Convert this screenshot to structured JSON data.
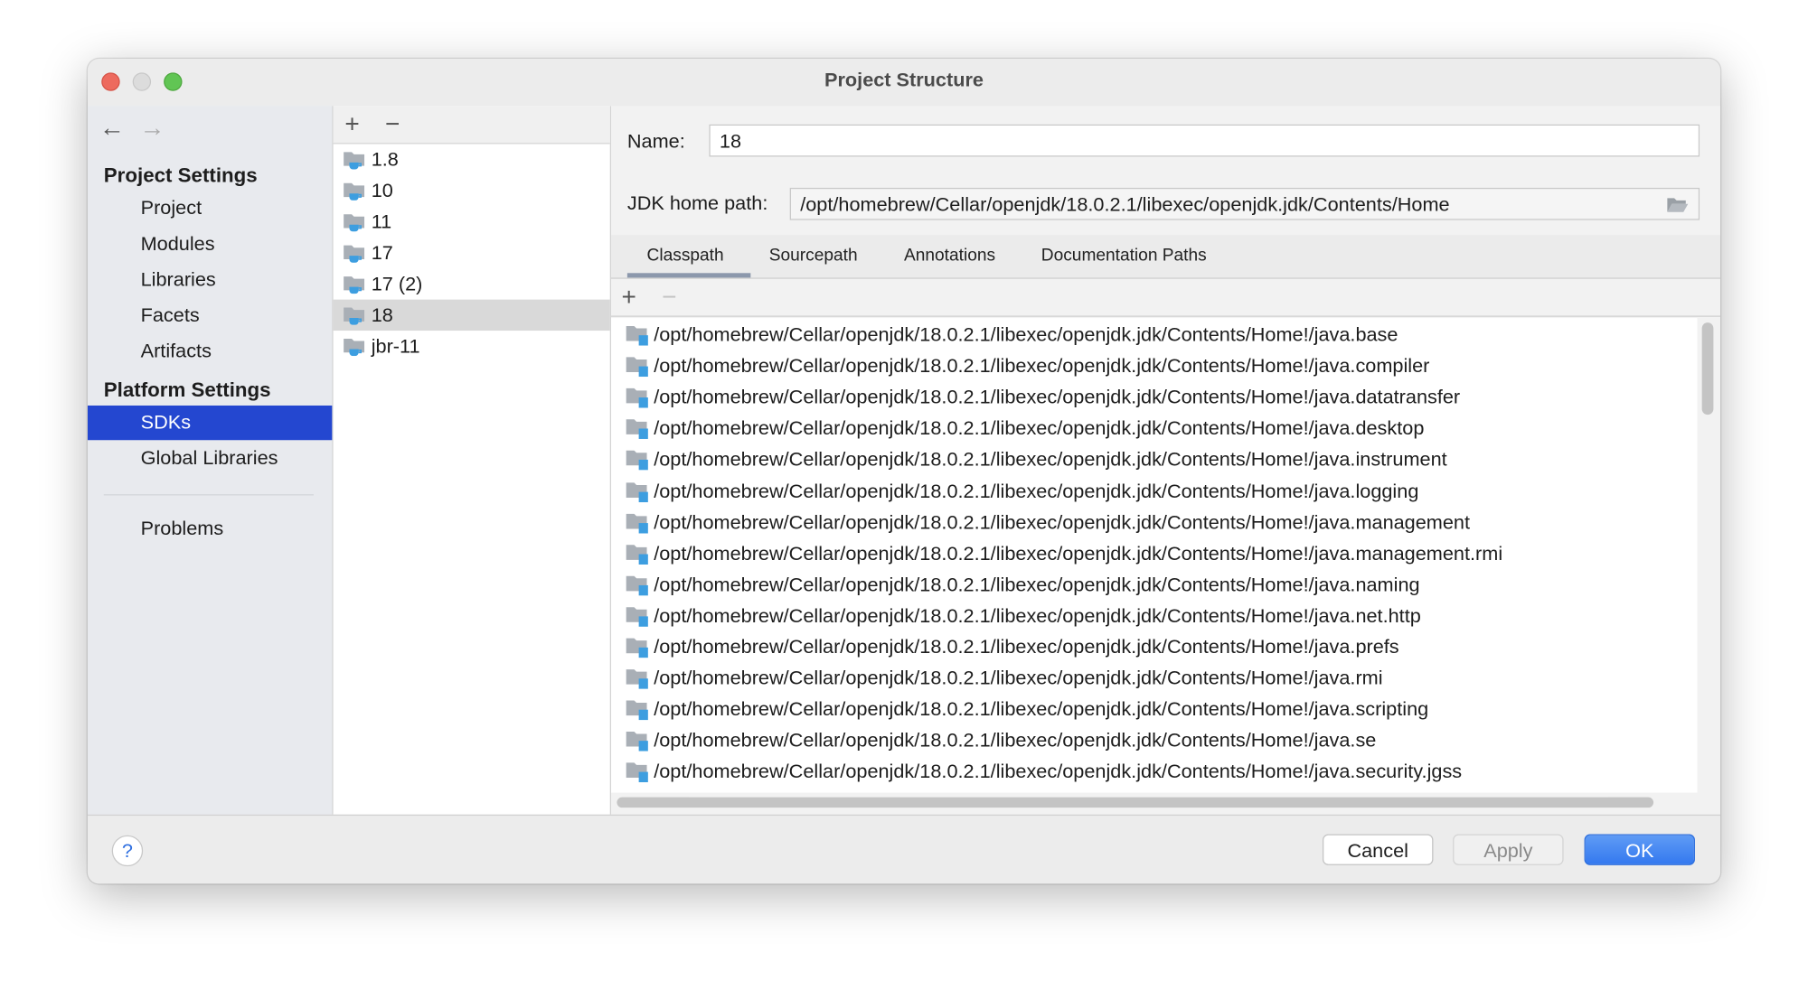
{
  "window": {
    "title": "Project Structure"
  },
  "sidebar": {
    "back_icon": "arrow-left-icon",
    "forward_icon": "arrow-right-icon",
    "project_settings_header": "Project Settings",
    "project_items": [
      {
        "label": "Project"
      },
      {
        "label": "Modules"
      },
      {
        "label": "Libraries"
      },
      {
        "label": "Facets"
      },
      {
        "label": "Artifacts"
      }
    ],
    "platform_settings_header": "Platform Settings",
    "platform_items": [
      {
        "label": "SDKs",
        "selected": true
      },
      {
        "label": "Global Libraries"
      }
    ],
    "problems": "Problems",
    "selected_color": "#2447d0"
  },
  "sdk_list": {
    "add": "+",
    "remove": "−",
    "items": [
      {
        "label": "1.8"
      },
      {
        "label": "10"
      },
      {
        "label": "11"
      },
      {
        "label": "17"
      },
      {
        "label": "17 (2)"
      },
      {
        "label": "18",
        "selected": true
      },
      {
        "label": "jbr-11"
      }
    ]
  },
  "detail": {
    "name_label": "Name:",
    "name_value": "18",
    "jdk_home_label": "JDK home path:",
    "jdk_home_value": "/opt/homebrew/Cellar/openjdk/18.0.2.1/libexec/openjdk.jdk/Contents/Home",
    "tabs": [
      {
        "label": "Classpath",
        "active": true
      },
      {
        "label": "Sourcepath"
      },
      {
        "label": "Annotations"
      },
      {
        "label": "Documentation Paths"
      }
    ],
    "add": "+",
    "remove": "−",
    "classpath": [
      "/opt/homebrew/Cellar/openjdk/18.0.2.1/libexec/openjdk.jdk/Contents/Home!/java.base",
      "/opt/homebrew/Cellar/openjdk/18.0.2.1/libexec/openjdk.jdk/Contents/Home!/java.compiler",
      "/opt/homebrew/Cellar/openjdk/18.0.2.1/libexec/openjdk.jdk/Contents/Home!/java.datatransfer",
      "/opt/homebrew/Cellar/openjdk/18.0.2.1/libexec/openjdk.jdk/Contents/Home!/java.desktop",
      "/opt/homebrew/Cellar/openjdk/18.0.2.1/libexec/openjdk.jdk/Contents/Home!/java.instrument",
      "/opt/homebrew/Cellar/openjdk/18.0.2.1/libexec/openjdk.jdk/Contents/Home!/java.logging",
      "/opt/homebrew/Cellar/openjdk/18.0.2.1/libexec/openjdk.jdk/Contents/Home!/java.management",
      "/opt/homebrew/Cellar/openjdk/18.0.2.1/libexec/openjdk.jdk/Contents/Home!/java.management.rmi",
      "/opt/homebrew/Cellar/openjdk/18.0.2.1/libexec/openjdk.jdk/Contents/Home!/java.naming",
      "/opt/homebrew/Cellar/openjdk/18.0.2.1/libexec/openjdk.jdk/Contents/Home!/java.net.http",
      "/opt/homebrew/Cellar/openjdk/18.0.2.1/libexec/openjdk.jdk/Contents/Home!/java.prefs",
      "/opt/homebrew/Cellar/openjdk/18.0.2.1/libexec/openjdk.jdk/Contents/Home!/java.rmi",
      "/opt/homebrew/Cellar/openjdk/18.0.2.1/libexec/openjdk.jdk/Contents/Home!/java.scripting",
      "/opt/homebrew/Cellar/openjdk/18.0.2.1/libexec/openjdk.jdk/Contents/Home!/java.se",
      "/opt/homebrew/Cellar/openjdk/18.0.2.1/libexec/openjdk.jdk/Contents/Home!/java.security.jgss"
    ]
  },
  "footer": {
    "help": "?",
    "cancel": "Cancel",
    "apply": "Apply",
    "ok": "OK",
    "ok_color": "#3b82f0"
  }
}
